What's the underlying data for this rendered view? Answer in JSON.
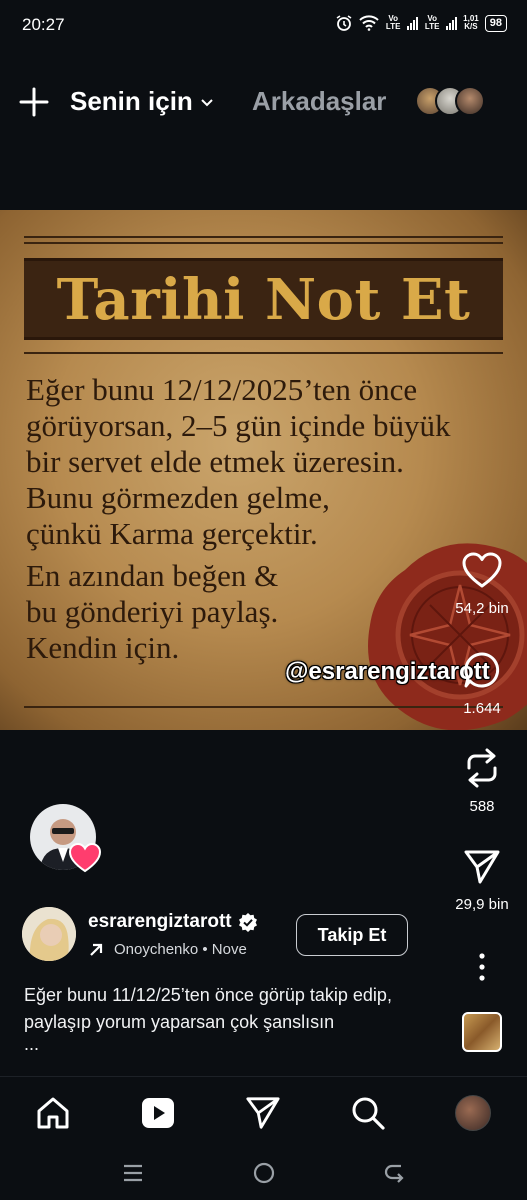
{
  "status_bar": {
    "time": "20:27",
    "network_1": "Vo LTE",
    "network_2": "Vo LTE",
    "speed_value": "1,01",
    "speed_unit": "K/S",
    "battery": "98"
  },
  "top_nav": {
    "for_you_label": "Senin için",
    "friends_label": "Arkadaşlar"
  },
  "post_image": {
    "title": "Tarihi Not Et",
    "lines": [
      "Eğer bunu 12/12/2025’ten önce",
      "görüyorsan, 2–5 gün içinde büyük",
      "bir servet elde etmek üzeresin.",
      "Bunu görmezden gelme,",
      "çünkü Karma gerçektir.",
      "En azından beğen &",
      "bu gönderiyi paylaş.",
      "Kendin için."
    ],
    "watermark": "@esrarengiztarott"
  },
  "actions": {
    "likes": "54,2 bin",
    "comments": "1.644",
    "reposts": "588",
    "shares": "29,9 bin"
  },
  "post": {
    "username": "esrarengiztarott",
    "audio_text": "Onoychenko • Nove",
    "follow_label": "Takip Et",
    "caption": "Eğer bunu 11/12/25’ten önce görüp takip edip, paylaşıp yorum yaparsan çok şanslısın",
    "caption_more": "..."
  },
  "colors": {
    "background": "#0b0e12",
    "parchment": "#b68a4f",
    "title_gold": "#d9a948",
    "wax_red": "#8e2a1c",
    "heart_pink": "#ff3d6e"
  }
}
